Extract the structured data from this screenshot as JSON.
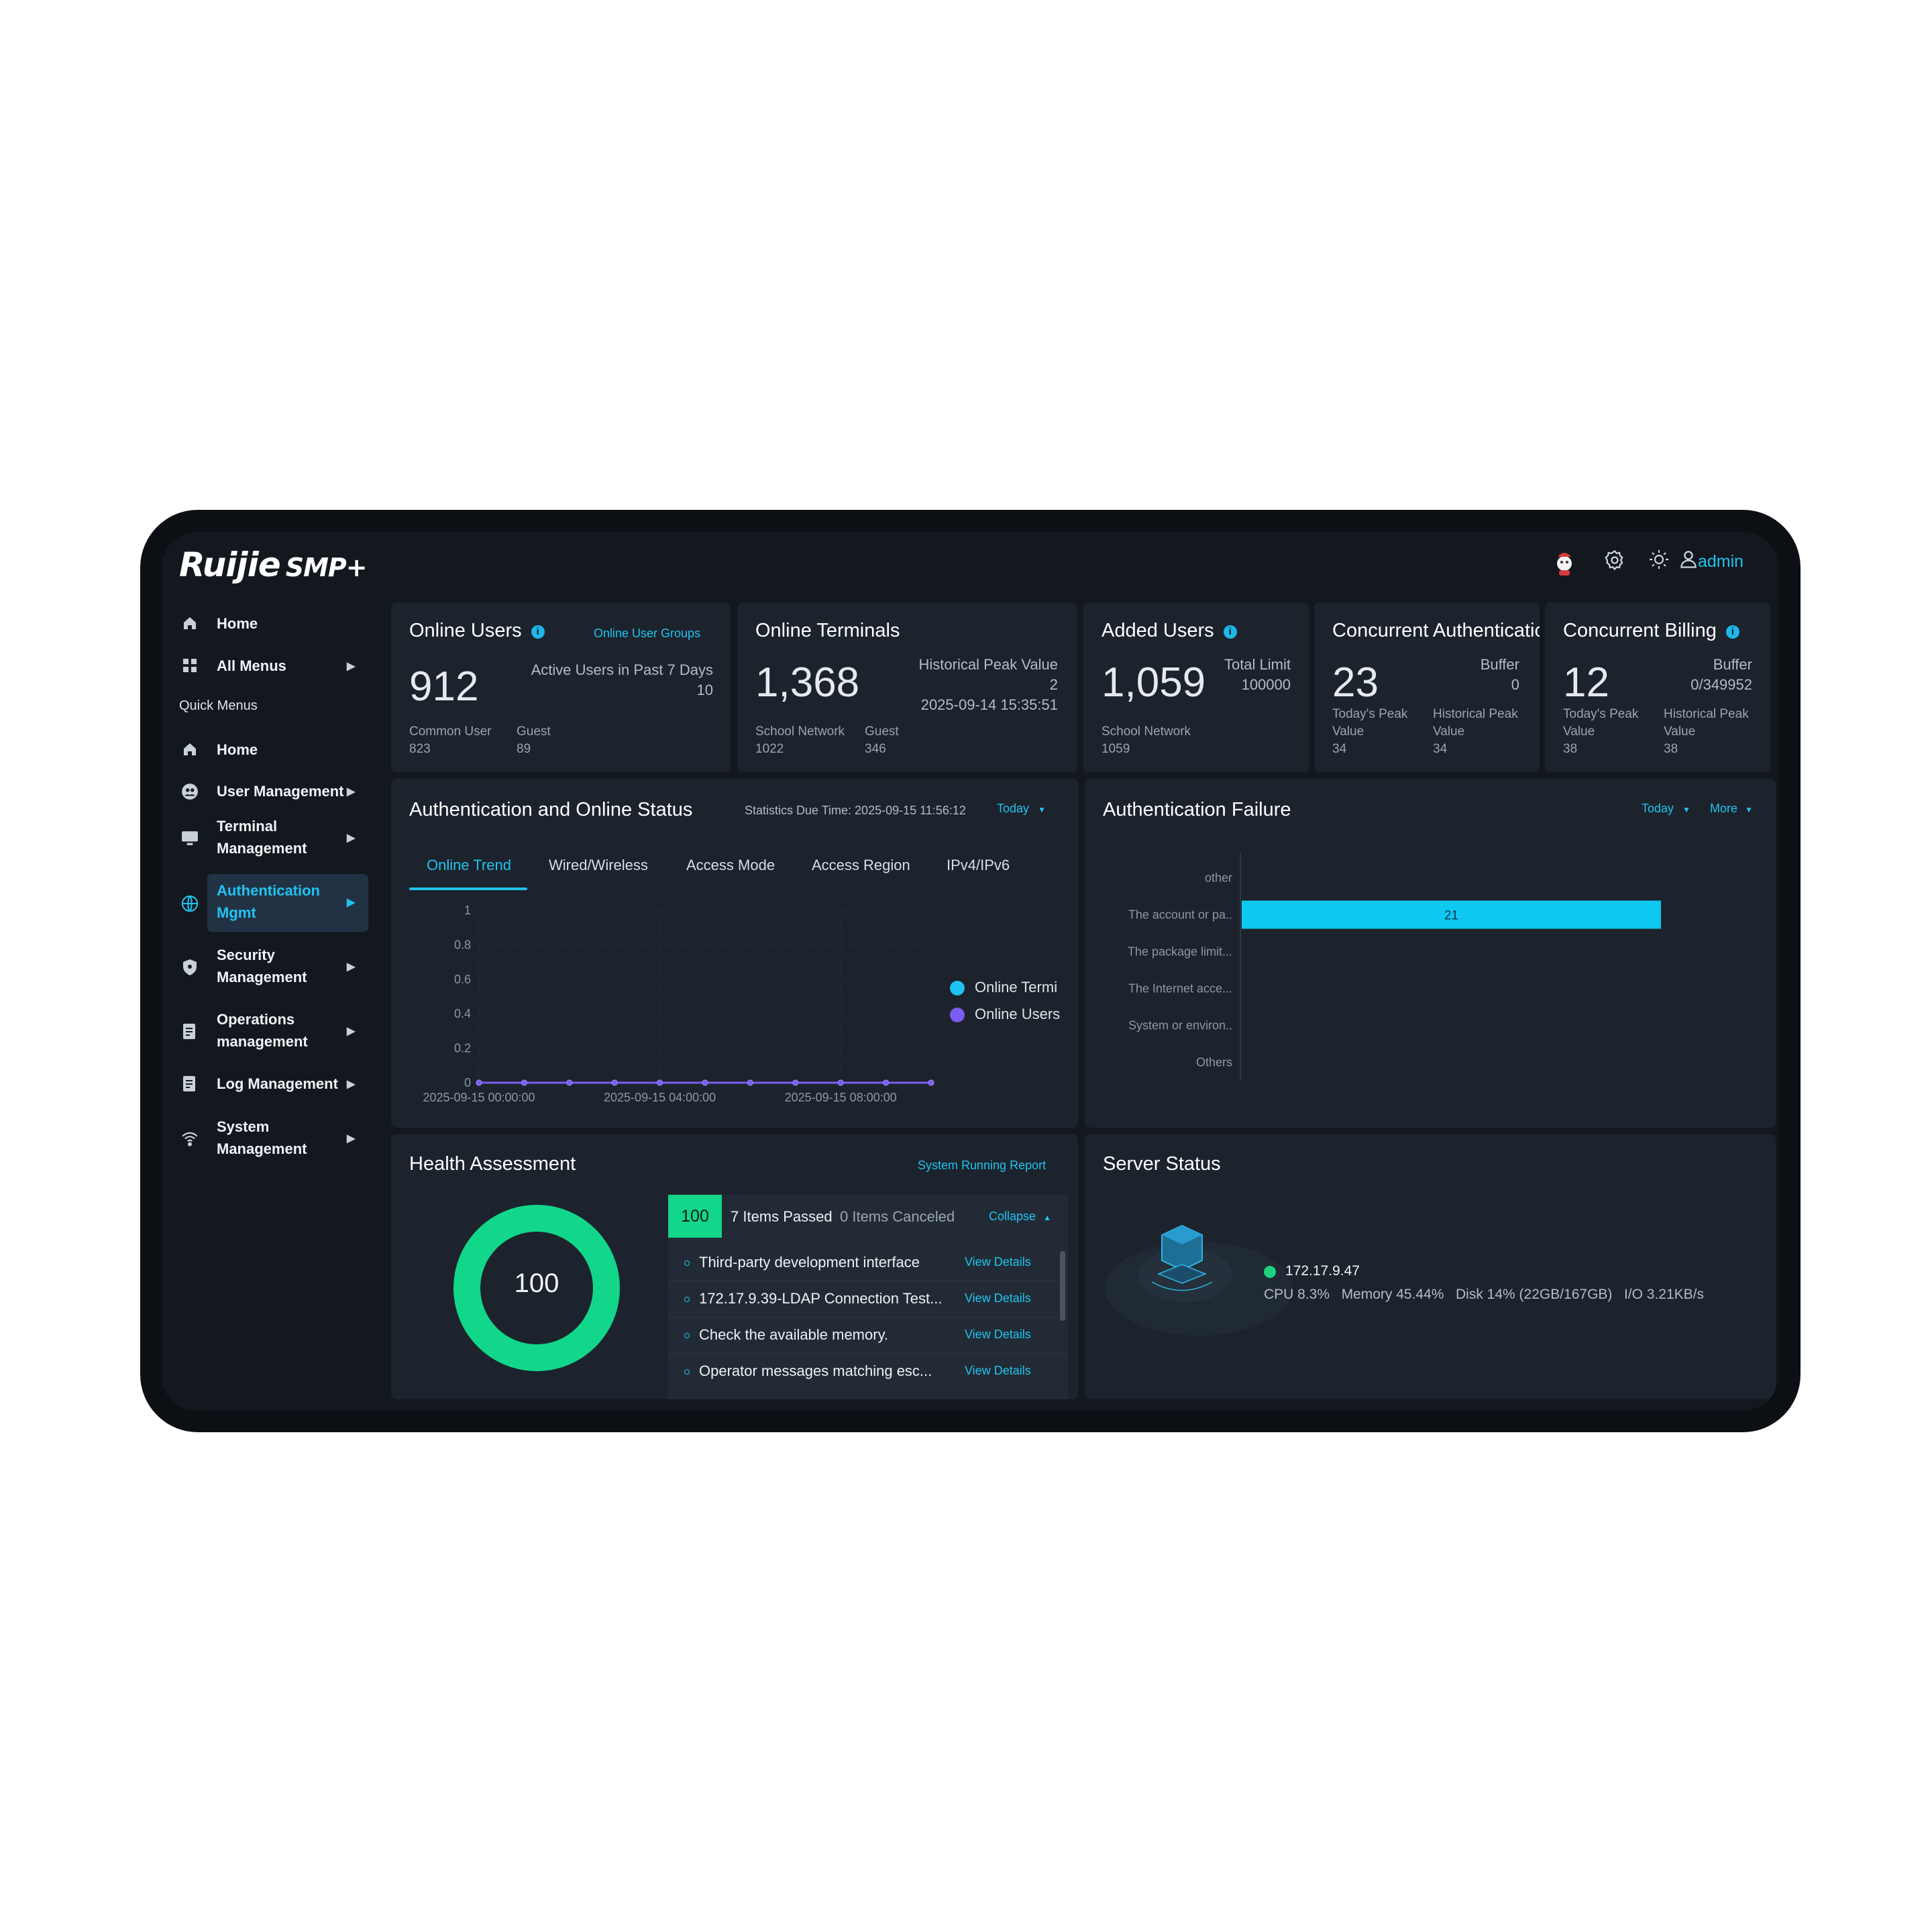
{
  "app": {
    "brand": "Ruijie",
    "product": "SMP+",
    "user": "admin"
  },
  "header_icons": [
    "mascot-icon",
    "settings-icon",
    "theme-sun-icon",
    "user-icon"
  ],
  "sidebar": {
    "top_items": [
      {
        "label": "Home",
        "icon": "home-icon"
      },
      {
        "label": "All Menus",
        "icon": "grid-icon"
      }
    ],
    "quick_title": "Quick Menus",
    "items": [
      {
        "label": "Home",
        "icon": "home-icon"
      },
      {
        "label": "User Management",
        "icon": "user-group-icon"
      },
      {
        "label": "Terminal Management",
        "line1": "Terminal",
        "line2": "Management",
        "icon": "monitor-icon"
      },
      {
        "label": "Authentication Mgmt",
        "line1": "Authentication",
        "line2": "Mgmt",
        "icon": "globe-icon",
        "active": true
      },
      {
        "label": "Security Management",
        "line1": "Security",
        "line2": "Management",
        "icon": "shield-icon"
      },
      {
        "label": "Operations management",
        "line1": "Operations",
        "line2": "management",
        "icon": "document-icon"
      },
      {
        "label": "Log Management",
        "icon": "log-icon"
      },
      {
        "label": "System Management",
        "line1": "System",
        "line2": "Management",
        "icon": "wifi-icon"
      }
    ]
  },
  "stats": {
    "online_users": {
      "title": "Online Users",
      "link": "Online User Groups",
      "value": "912",
      "right_label": "Active Users in Past 7 Days",
      "right_value": "10",
      "sub1_label": "Common User",
      "sub1_value": "823",
      "sub2_label": "Guest",
      "sub2_value": "89"
    },
    "online_terminals": {
      "title": "Online Terminals",
      "value": "1,368",
      "right_label": "Historical Peak Value",
      "right_value": "2",
      "right_date": "2025-09-14 15:35:51",
      "sub1_label": "School Network",
      "sub1_value": "1022",
      "sub2_label": "Guest",
      "sub2_value": "346"
    },
    "added_users": {
      "title": "Added Users",
      "value": "1,059",
      "right_label": "Total Limit",
      "right_value": "100000",
      "sub1_label": "School Network",
      "sub1_value": "1059"
    },
    "concurrent_auth": {
      "title": "Concurrent Authenticatic",
      "value": "23",
      "right_label": "Buffer",
      "right_value": "0",
      "sub1_label": "Today's Peak Value",
      "sub1_value": "34",
      "sub2_label": "Historical Peak Value",
      "sub2_value": "34"
    },
    "concurrent_billing": {
      "title": "Concurrent Billing",
      "value": "12",
      "right_label": "Buffer",
      "right_value": "0/349952",
      "sub1_label": "Today's Peak Value",
      "sub1_value": "38",
      "sub2_label": "Historical Peak Value",
      "sub2_value": "38"
    }
  },
  "auth_status": {
    "title": "Authentication and Online Status",
    "due_time": "Statistics Due Time: 2025-09-15 11:56:12",
    "period": "Today",
    "tabs": [
      "Online Trend",
      "Wired/Wireless",
      "Access Mode",
      "Access Region",
      "IPv4/IPv6"
    ],
    "active_tab": 0
  },
  "auth_failure": {
    "title": "Authentication Failure",
    "period": "Today",
    "more": "More"
  },
  "health": {
    "title": "Health Assessment",
    "link": "System Running Report",
    "score": "100",
    "badge": "100",
    "passed": "7 Items Passed",
    "canceled": "0 Items Canceled",
    "collapse": "Collapse",
    "items": [
      {
        "text": "Third-party development interface",
        "action": "View Details"
      },
      {
        "text": "172.17.9.39-LDAP Connection Test...",
        "action": "View Details"
      },
      {
        "text": "Check the available memory.",
        "action": "View Details"
      },
      {
        "text": "Operator messages matching esc...",
        "action": "View Details"
      }
    ]
  },
  "server": {
    "title": "Server Status",
    "ip": "172.17.9.47",
    "cpu": "CPU 8.3%",
    "memory": "Memory 45.44%",
    "disk": "Disk 14% (22GB/167GB)",
    "io": "I/O 3.21KB/s",
    "status_color": "#1ed17e"
  },
  "colors": {
    "accent": "#1fc3ef",
    "health_ring": "#12d68a",
    "series_terminals": "#1fc3ef",
    "series_users": "#7b5cf0",
    "bar": "#0fc8f0"
  },
  "chart_data": [
    {
      "type": "line",
      "x": [
        "2025-09-15 00:00:00",
        "2025-09-15 01:00:00",
        "2025-09-15 02:00:00",
        "2025-09-15 03:00:00",
        "2025-09-15 04:00:00",
        "2025-09-15 05:00:00",
        "2025-09-15 06:00:00",
        "2025-09-15 07:00:00",
        "2025-09-15 08:00:00",
        "2025-09-15 09:00:00",
        "2025-09-15 10:00:00"
      ],
      "xtick_labels": [
        "2025-09-15 00:00:00",
        "2025-09-15 04:00:00",
        "2025-09-15 08:00:00"
      ],
      "yticks": [
        "0",
        "0.2",
        "0.4",
        "0.6",
        "0.8",
        "1"
      ],
      "ylim": [
        0,
        1
      ],
      "series": [
        {
          "name": "Online Termi",
          "values": [
            0,
            0,
            0,
            0,
            0,
            0,
            0,
            0,
            0,
            0,
            0
          ]
        },
        {
          "name": "Online Users",
          "values": [
            0,
            0,
            0,
            0,
            0,
            0,
            0,
            0,
            0,
            0,
            0
          ]
        }
      ],
      "legend": "right"
    },
    {
      "type": "bar",
      "orientation": "horizontal",
      "categories": [
        "other",
        "The account or pa..",
        "The package limit...",
        "The Internet acce...",
        "System or environ..",
        "Others"
      ],
      "values": [
        0,
        21,
        0,
        0,
        0,
        0
      ],
      "data_labels": [
        "",
        "21",
        "",
        "",
        "",
        ""
      ]
    }
  ]
}
